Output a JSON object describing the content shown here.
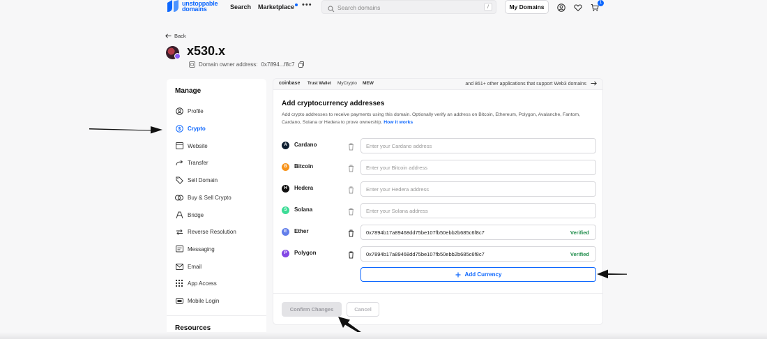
{
  "header": {
    "logo_line1": "unstoppable",
    "logo_line2": "domains",
    "nav_search": "Search",
    "nav_marketplace": "Marketplace",
    "more": "•••",
    "search_placeholder": "Search domains",
    "search_shortcut": "/",
    "my_domains": "My Domains",
    "cart_count": "1"
  },
  "page": {
    "back": "Back",
    "domain": "x530.x",
    "owner_label": "Domain owner address:",
    "owner_address": "0x7894...f8c7"
  },
  "sidebar": {
    "manage_title": "Manage",
    "items": [
      {
        "label": "Profile",
        "icon": "profile-icon"
      },
      {
        "label": "Crypto",
        "icon": "crypto-icon"
      },
      {
        "label": "Website",
        "icon": "website-icon"
      },
      {
        "label": "Transfer",
        "icon": "transfer-icon"
      },
      {
        "label": "Sell Domain",
        "icon": "tag-icon"
      },
      {
        "label": "Buy & Sell Crypto",
        "icon": "coins-icon"
      },
      {
        "label": "Bridge",
        "icon": "bridge-icon"
      },
      {
        "label": "Reverse Resolution",
        "icon": "swap-icon"
      },
      {
        "label": "Messaging",
        "icon": "message-icon"
      },
      {
        "label": "Email",
        "icon": "email-icon"
      },
      {
        "label": "App Access",
        "icon": "grid-icon"
      },
      {
        "label": "Mobile Login",
        "icon": "mobile-login-icon"
      }
    ],
    "resources_title": "Resources"
  },
  "wallets": {
    "coinbase": "coinbase",
    "trust": "Trust Wallet",
    "mycrypto": "MyCrypto",
    "mew": "MEW",
    "more_apps": "and 861+ other applications that support Web3 domains"
  },
  "card": {
    "title": "Add cryptocurrency addresses",
    "description": "Add crypto addresses to receive payments using this domain. Optionally verify an address on Bitcoin, Ethereum, Polygon, Avalanche, Fantom, Cardano, Solana or Hedera to prove ownership.",
    "how_link": "How it works",
    "currencies": [
      {
        "name": "Cardano",
        "placeholder": "Enter your Cardano address",
        "value": "",
        "status": "",
        "color": "#0d1e30",
        "symbol": "A"
      },
      {
        "name": "Bitcoin",
        "placeholder": "Enter your Bitcoin address",
        "value": "",
        "status": "",
        "color": "#f7931a",
        "symbol": "B"
      },
      {
        "name": "Hedera",
        "placeholder": "Enter your Hedera address",
        "value": "",
        "status": "",
        "color": "#111111",
        "symbol": "H"
      },
      {
        "name": "Solana",
        "placeholder": "Enter your Solana address",
        "value": "",
        "status": "",
        "color": "#3ddc97",
        "symbol": "S"
      },
      {
        "name": "Ether",
        "placeholder": "",
        "value": "0x7894b17a89468dd75be107fb50ebb2b685c6f8c7",
        "status": "Verified",
        "color": "#627eea",
        "symbol": "E"
      },
      {
        "name": "Polygon",
        "placeholder": "",
        "value": "0x7894b17a89468dd75be107fb50ebb2b685c6f8c7",
        "status": "Verified",
        "color": "#8247e5",
        "symbol": "P"
      }
    ],
    "add_currency": "Add Currency",
    "confirm": "Confirm Changes",
    "cancel": "Cancel"
  },
  "colors": {
    "accent": "#0d67fe",
    "verified": "#1e8c4a"
  }
}
